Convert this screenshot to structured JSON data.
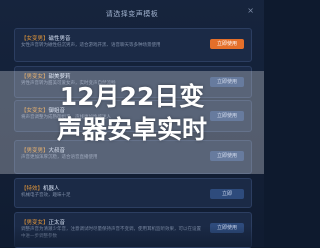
{
  "dialog": {
    "title": "请选择变声模板",
    "close_glyph": "×"
  },
  "cards": [
    {
      "tag": "【女变男】",
      "name": "磁性男音",
      "desc": "女性声音转为磁性低沉男声，适合游戏开黑、语音聊天等多种场景使用",
      "button": "立即使用"
    },
    {
      "tag": "【男变女】",
      "name": "甜美萝莉",
      "desc": "男性声音转为甜美可爱女声，实时变声自然流畅",
      "button": "立即使用"
    },
    {
      "tag": "【女变女】",
      "name": "御姐音",
      "desc": "将声音调整为成熟御姐音，声线更加性感迷人",
      "button": "立即使用"
    },
    {
      "tag": "【男变男】",
      "name": "大叔音",
      "desc": "声音更加浑厚沉稳，适合语音直播使用",
      "button": "立即使用"
    },
    {
      "tag": "【特效】",
      "name": "机器人",
      "desc": "机械电子音效，趣味十足",
      "button": "立即"
    },
    {
      "tag": "【男变女】",
      "name": "正太音",
      "desc": "调整声音为清澈少年音，注意调试时尽量保持声音不变调，使用耳机监听效果，可以在设置中进一步调整参数",
      "button": "立即使用"
    }
  ],
  "headline": {
    "line1": "12月22日变",
    "line2": "声器安卓实时"
  }
}
